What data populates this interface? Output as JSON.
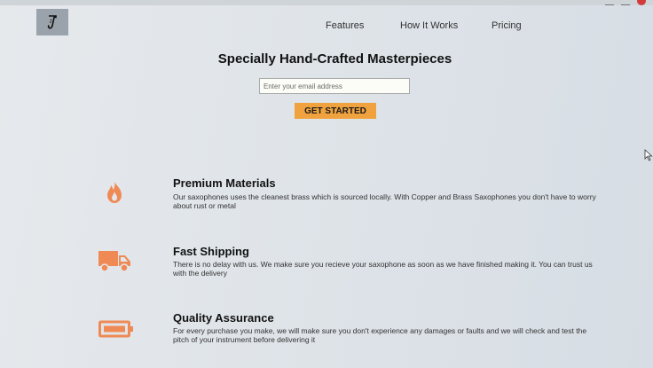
{
  "nav": {
    "items": [
      "Features",
      "How It Works",
      "Pricing"
    ]
  },
  "hero": {
    "title": "Specially Hand-Crafted Masterpieces",
    "email_placeholder": "Enter your email address",
    "cta_label": "GET STARTED"
  },
  "features": [
    {
      "icon": "flame-icon",
      "title": "Premium Materials",
      "text": "Our saxophones uses the cleanest brass which is sourced locally. With Copper and Brass Saxophones you don't have to worry about rust or metal"
    },
    {
      "icon": "truck-icon",
      "title": "Fast Shipping",
      "text": "There is no delay with us. We make sure you recieve your saxophone as soon as we have finished making it. You can trust us with the delivery"
    },
    {
      "icon": "battery-icon",
      "title": "Quality Assurance",
      "text": "For every purchase you make, we will make sure you don't experience any damages or faults and we will check and test the pitch of your instrument before delivering it"
    }
  ],
  "colors": {
    "accent": "#f0a23f",
    "icon": "#ef8a55",
    "background": "#e1e5e9"
  }
}
